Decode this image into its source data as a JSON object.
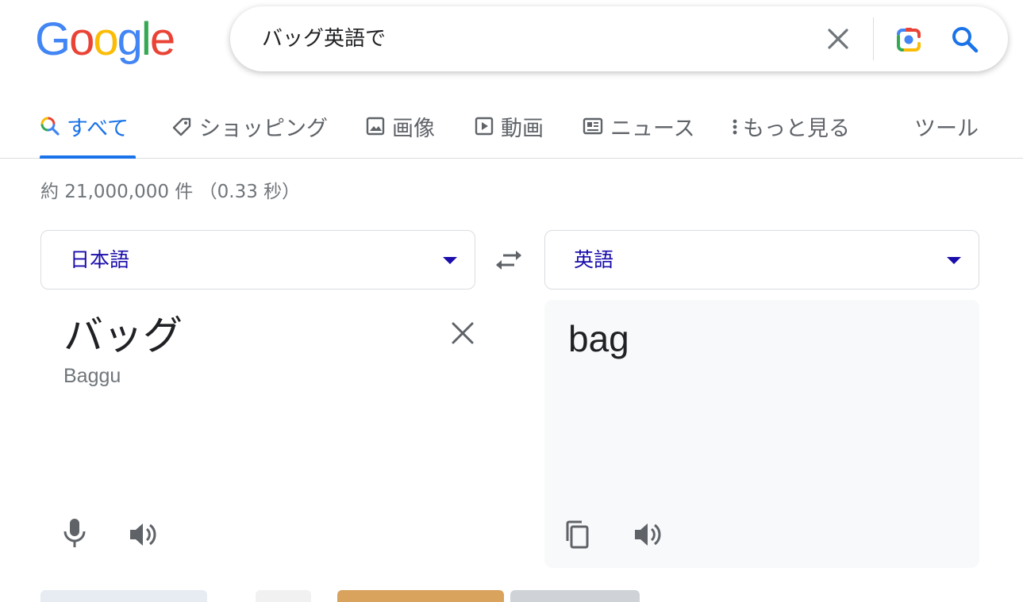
{
  "header": {
    "logo_letters": [
      "G",
      "o",
      "o",
      "g",
      "l",
      "e"
    ],
    "search_query": "バッグ英語で",
    "icons": {
      "clear": "close-icon",
      "lens": "camera-lens-icon",
      "search": "search-icon"
    }
  },
  "tabs": [
    {
      "label": "すべて",
      "icon": "search-multicolor-icon",
      "active": true
    },
    {
      "label": "ショッピング",
      "icon": "tag-icon",
      "active": false
    },
    {
      "label": "画像",
      "icon": "image-icon",
      "active": false
    },
    {
      "label": "動画",
      "icon": "play-icon",
      "active": false
    },
    {
      "label": "ニュース",
      "icon": "newspaper-icon",
      "active": false
    },
    {
      "label": "もっと見る",
      "icon": "more-vert-icon",
      "active": false
    }
  ],
  "tools_label": "ツール",
  "result_stats": "約 21,000,000 件 （0.33 秒）",
  "translator": {
    "source_lang": "日本語",
    "target_lang": "英語",
    "source_text": "バッグ",
    "source_transliteration": "Baggu",
    "target_text": "bag"
  },
  "colors": {
    "accent": "#1a73e8",
    "link_blue": "#1a0dab",
    "muted": "#70757a",
    "panel_bg": "#f8f9fa",
    "border": "#dadce0"
  }
}
